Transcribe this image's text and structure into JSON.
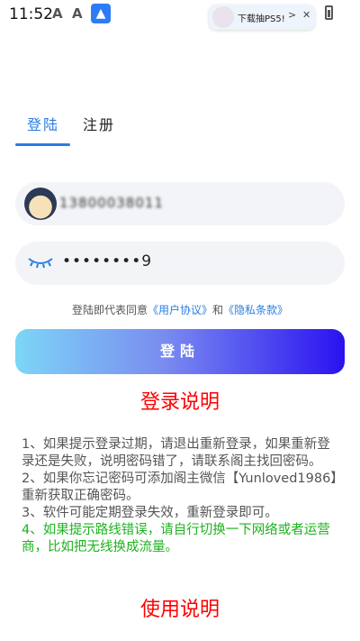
{
  "status_bar": {
    "time": "11:52",
    "icons": [
      "A",
      "A"
    ],
    "notification": {
      "text": "下载抽PS5!",
      "chevron": ">",
      "close": "✕"
    }
  },
  "tabs": [
    {
      "label": "登陆",
      "active": true
    },
    {
      "label": "注册",
      "active": false
    }
  ],
  "form": {
    "username_value": "13800038011",
    "password_value": "••••••••9"
  },
  "agreement": {
    "prefix": "登陆即代表同意",
    "user_agreement": "《用户协议》",
    "and": "和",
    "privacy": "《隐私条款》"
  },
  "login_button": "登陆",
  "login_notes_title": "登录说明",
  "notes": [
    "1、如果提示登录过期，请退出重新登录，如果重新登录还是失败，说明密码错了，请联系阁主找回密码。",
    "2、如果你忘记密码可添加阁主微信【Yunloved1986】重新获取正确密码。",
    "3、软件可能定期登录失效，重新登录即可。",
    "4、如果提示路线错误，请自行切换一下网络或者运营商，比如把无线换成流量。"
  ],
  "usage_title": "使用说明",
  "colors": {
    "accent": "#2a7de1",
    "warning": "#ff0000",
    "tip": "#1db31d"
  }
}
